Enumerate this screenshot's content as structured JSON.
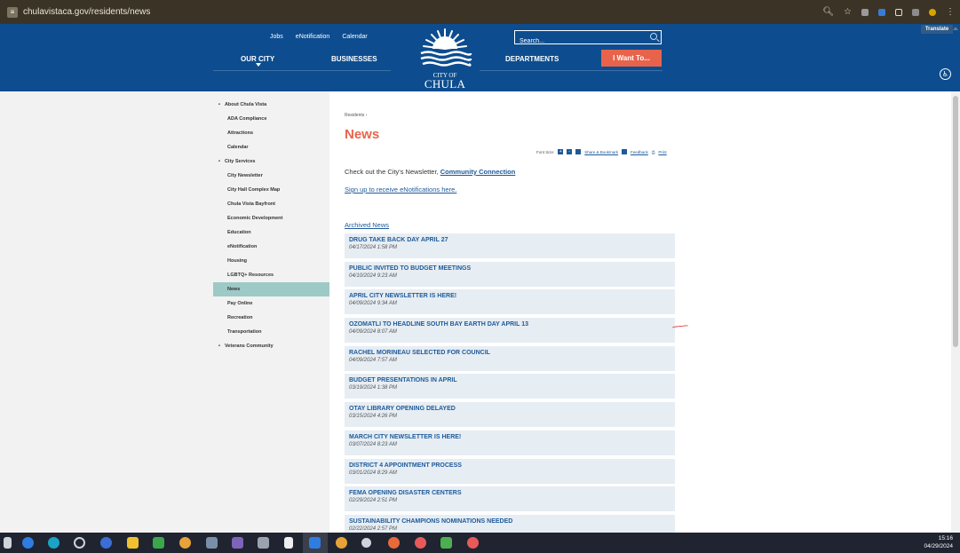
{
  "browser": {
    "url": "chulavistaca.gov/residents/news"
  },
  "header": {
    "top_links": [
      "Jobs",
      "eNotification",
      "Calendar"
    ],
    "nav": {
      "our_city": "OUR CITY",
      "businesses": "BUSINESSES",
      "departments": "DEPARTMENTS"
    },
    "search_placeholder": "Search...",
    "i_want_to": "I Want To...",
    "logo_city_of": "CITY OF",
    "logo_name": "CHULA VISTA",
    "translate": "Translate",
    "colors": {
      "header_bg": "#0d4d8f",
      "accent": "#e8634b"
    }
  },
  "sidebar": {
    "items": [
      {
        "label": "About Chula Vista",
        "bullet": true
      },
      {
        "label": "ADA Compliance"
      },
      {
        "label": "Attractions"
      },
      {
        "label": "Calendar"
      },
      {
        "label": "City Services",
        "bullet": true
      },
      {
        "label": "City Newsletter"
      },
      {
        "label": "City Hall Complex Map"
      },
      {
        "label": "Chula Vista Bayfront"
      },
      {
        "label": "Economic Development"
      },
      {
        "label": "Education"
      },
      {
        "label": "eNotification"
      },
      {
        "label": "Housing"
      },
      {
        "label": "LGBTQ+ Resources"
      },
      {
        "label": "News",
        "active": true
      },
      {
        "label": "Pay Online"
      },
      {
        "label": "Recreation"
      },
      {
        "label": "Transportation"
      },
      {
        "label": "Veterans Community",
        "bullet": true
      }
    ]
  },
  "content": {
    "breadcrumb": "Residents",
    "title": "News",
    "tools": {
      "font_size": "Font Size:",
      "plus": "+",
      "minus": "-",
      "share": "Share & Bookmark",
      "feedback": "Feedback",
      "print": "Print"
    },
    "intro_text": "Check out the City's Newsletter, ",
    "intro_link": "Community Connection",
    "signup": "Sign up to receive eNotifications here.",
    "archived": "Archived News",
    "news": [
      {
        "title": "DRUG TAKE BACK DAY APRIL 27",
        "date": "04/17/2024 1:58 PM"
      },
      {
        "title": "PUBLIC INVITED TO BUDGET MEETINGS",
        "date": "04/10/2024 9:23 AM"
      },
      {
        "title": "APRIL CITY NEWSLETTER IS HERE!",
        "date": "04/09/2024 9:34 AM"
      },
      {
        "title": "OZOMATLI TO HEADLINE SOUTH BAY EARTH DAY APRIL 13",
        "date": "04/09/2024 8:07 AM"
      },
      {
        "title": "RACHEL MORINEAU SELECTED FOR COUNCIL",
        "date": "04/09/2024 7:57 AM"
      },
      {
        "title": "BUDGET PRESENTATIONS IN APRIL",
        "date": "03/19/2024 1:38 PM"
      },
      {
        "title": "OTAY LIBRARY OPENING DELAYED",
        "date": "03/15/2024 4:26 PM"
      },
      {
        "title": "MARCH CITY NEWSLETTER IS HERE!",
        "date": "03/07/2024 8:23 AM"
      },
      {
        "title": "DISTRICT 4 APPOINTMENT PROCESS",
        "date": "03/01/2024 8:29 AM"
      },
      {
        "title": "FEMA OPENING DISASTER CENTERS",
        "date": "02/29/2024 2:51 PM"
      },
      {
        "title": "SUSTAINABILITY CHAMPIONS NOMINATIONS NEEDED",
        "date": "02/22/2024 2:57 PM"
      }
    ]
  },
  "taskbar": {
    "time": "15:16",
    "date": "04/29/2024"
  }
}
